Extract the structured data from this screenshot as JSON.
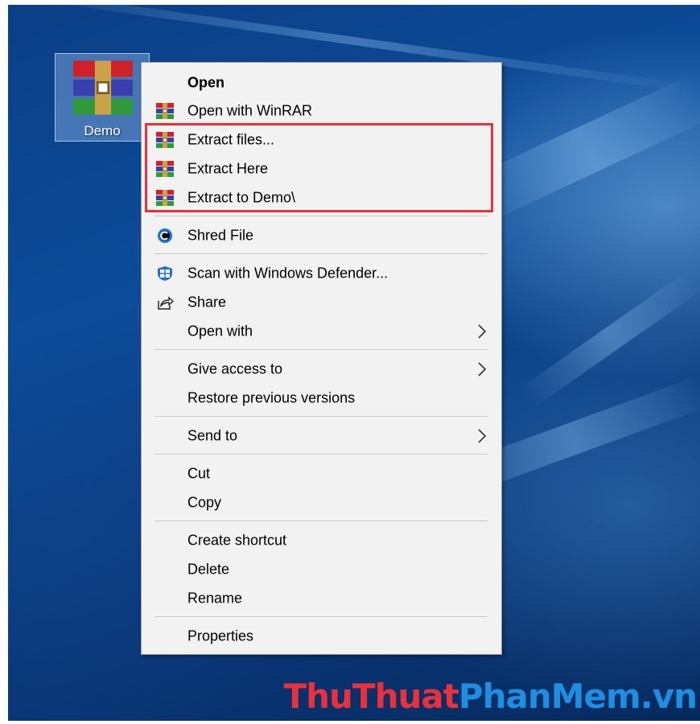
{
  "desktop": {
    "file_icon": {
      "name": "Demo",
      "icon": "winrar-archive-icon"
    }
  },
  "context_menu": {
    "items": [
      {
        "label": "Open",
        "bold": true,
        "icon": null,
        "submenu": false
      },
      {
        "label": "Open with WinRAR",
        "icon": "winrar-icon",
        "submenu": false
      },
      {
        "label": "Extract files...",
        "icon": "winrar-icon",
        "submenu": false,
        "highlighted": true
      },
      {
        "label": "Extract Here",
        "icon": "winrar-icon",
        "submenu": false,
        "highlighted": true
      },
      {
        "label": "Extract to Demo\\",
        "icon": "winrar-icon",
        "submenu": false,
        "highlighted": true
      },
      {
        "label": "Shred File",
        "icon": "shred-icon",
        "submenu": false
      },
      {
        "label": "Scan with Windows Defender...",
        "icon": "windows-defender-icon",
        "submenu": false
      },
      {
        "label": "Share",
        "icon": "share-icon",
        "submenu": false
      },
      {
        "label": "Open with",
        "icon": null,
        "submenu": true
      },
      {
        "label": "Give access to",
        "icon": null,
        "submenu": true
      },
      {
        "label": "Restore previous versions",
        "icon": null,
        "submenu": false
      },
      {
        "label": "Send to",
        "icon": null,
        "submenu": true
      },
      {
        "label": "Cut",
        "icon": null,
        "submenu": false
      },
      {
        "label": "Copy",
        "icon": null,
        "submenu": false
      },
      {
        "label": "Create shortcut",
        "icon": null,
        "submenu": false
      },
      {
        "label": "Delete",
        "icon": null,
        "submenu": false
      },
      {
        "label": "Rename",
        "icon": null,
        "submenu": false
      },
      {
        "label": "Properties",
        "icon": null,
        "submenu": false
      }
    ]
  },
  "colors": {
    "highlight_border": "#e8313a",
    "menu_background": "#f2f2f2",
    "desktop_blue": "#0d4c9a"
  },
  "watermark": {
    "part1": "ThuThuat",
    "part2": "PhanMem.vn"
  }
}
